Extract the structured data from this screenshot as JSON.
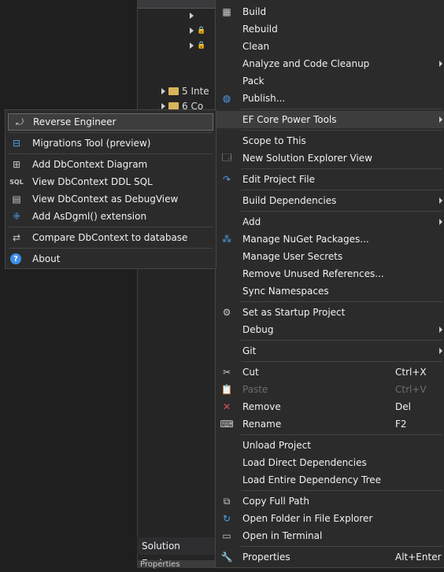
{
  "solution_explorer": {
    "rows": [
      "5 Inte",
      "6 Co"
    ],
    "footer": "Solution Explorer",
    "properties": "Properties"
  },
  "context_menu": {
    "build": "Build",
    "rebuild": "Rebuild",
    "clean": "Clean",
    "analyze": "Analyze and Code Cleanup",
    "pack": "Pack",
    "publish": "Publish...",
    "ef_core": "EF Core Power Tools",
    "scope": "Scope to This",
    "new_view": "New Solution Explorer View",
    "edit_project": "Edit Project File",
    "build_deps": "Build Dependencies",
    "add": "Add",
    "nuget": "Manage NuGet Packages...",
    "user_secrets": "Manage User Secrets",
    "remove_refs": "Remove Unused References...",
    "sync_ns": "Sync Namespaces",
    "startup": "Set as Startup Project",
    "debug": "Debug",
    "git": "Git",
    "cut": "Cut",
    "cut_shortcut": "Ctrl+X",
    "paste": "Paste",
    "paste_shortcut": "Ctrl+V",
    "remove": "Remove",
    "remove_shortcut": "Del",
    "rename": "Rename",
    "rename_shortcut": "F2",
    "unload": "Unload Project",
    "load_direct": "Load Direct Dependencies",
    "load_tree": "Load Entire Dependency Tree",
    "copy_path": "Copy Full Path",
    "open_folder": "Open Folder in File Explorer",
    "open_terminal": "Open in Terminal",
    "properties": "Properties",
    "properties_shortcut": "Alt+Enter"
  },
  "ef_submenu": {
    "reverse": "Reverse Engineer",
    "migrations": "Migrations Tool (preview)",
    "diagram": "Add DbContext Diagram",
    "ddl": "View DbContext DDL SQL",
    "debugview": "View DbContext as DebugView",
    "dgml": "Add AsDgml() extension",
    "compare": "Compare DbContext to database",
    "about": "About"
  },
  "colors": {
    "menu_bg": "#2b2b2b",
    "highlight": "#3d3d3d",
    "accent": "#4e9fe8"
  }
}
